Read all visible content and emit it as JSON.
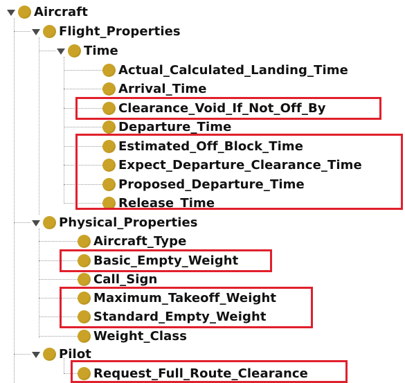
{
  "tree": {
    "root": {
      "label": "Aircraft"
    },
    "flight_properties": {
      "label": "Flight_Properties"
    },
    "time": {
      "label": "Time"
    },
    "time_items": [
      "Actual_Calculated_Landing_Time",
      "Arrival_Time",
      "Clearance_Void_If_Not_Off_By",
      "Departure_Time",
      "Estimated_Off_Block_Time",
      "Expect_Departure_Clearance_Time",
      "Proposed_Departure_Time",
      "Release_Time"
    ],
    "physical_properties": {
      "label": "Physical_Properties"
    },
    "physical_items": [
      "Aircraft_Type",
      "Basic_Empty_Weight",
      "Call_Sign",
      "Maximum_Takeoff_Weight",
      "Standard_Empty_Weight",
      "Weight_Class"
    ],
    "pilot": {
      "label": "Pilot"
    },
    "pilot_items": [
      "Request_Full_Route_Clearance"
    ]
  },
  "colors": {
    "node_dot": "#c9a227",
    "highlight_border": "#e0202c",
    "expand_arrow": "#4a4a4a"
  },
  "icons": {
    "node": "class-node-icon",
    "expanded": "expand-triangle-icon"
  }
}
